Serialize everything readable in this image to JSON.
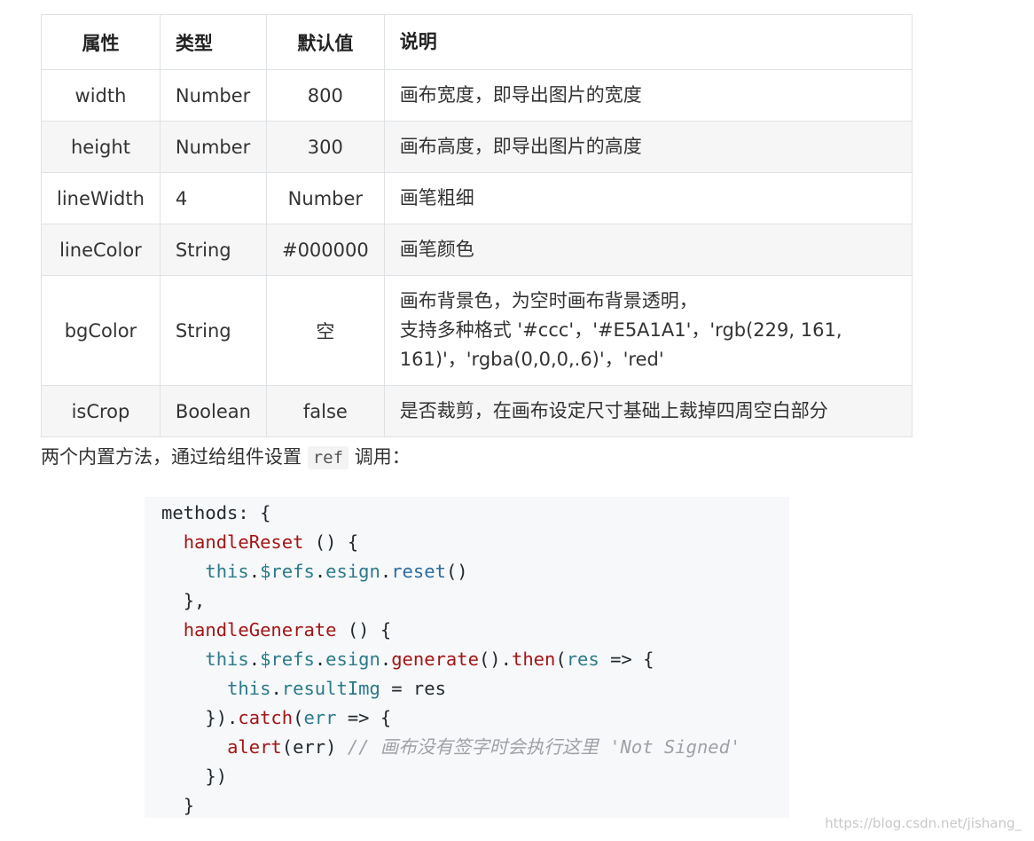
{
  "table": {
    "headers": [
      "属性",
      "类型",
      "默认值",
      "说明"
    ],
    "rows": [
      {
        "prop": "width",
        "type": "Number",
        "default": "800",
        "desc_lines": [
          "画布宽度，即导出图片的宽度"
        ]
      },
      {
        "prop": "height",
        "type": "Number",
        "default": "300",
        "desc_lines": [
          "画布高度，即导出图片的高度"
        ]
      },
      {
        "prop": "lineWidth",
        "type": "4",
        "default": "Number",
        "desc_lines": [
          "画笔粗细"
        ]
      },
      {
        "prop": "lineColor",
        "type": "String",
        "default": "#000000",
        "desc_lines": [
          "画笔颜色"
        ]
      },
      {
        "prop": "bgColor",
        "type": "String",
        "default": "空",
        "desc_lines": [
          "画布背景色，为空时画布背景透明，",
          "支持多种格式 '#ccc'，'#E5A1A1'，'rgb(229, 161,",
          "161)'，'rgba(0,0,0,.6)'，'red'"
        ]
      },
      {
        "prop": "isCrop",
        "type": "Boolean",
        "default": "false",
        "desc_lines": [
          "是否裁剪，在画布设定尺寸基础上裁掉四周空白部分"
        ]
      }
    ]
  },
  "intro": {
    "before": "两个内置方法，通过给组件设置 ",
    "code": "ref",
    "after": " 调用："
  },
  "code": {
    "l1_a": "methods: {",
    "l2_fn": "handleReset",
    "l2_rest": " () {",
    "l3_this": "this",
    "l3_dot1": ".",
    "l3_refs": "$refs",
    "l3_dot2": ".",
    "l3_esign": "esign",
    "l3_dot3": ".",
    "l3_reset": "reset",
    "l3_rest": "()",
    "l4": "},",
    "l5_fn": "handleGenerate",
    "l5_rest": " () {",
    "l6_this": "this",
    "l6_dot1": ".",
    "l6_refs": "$refs",
    "l6_dot2": ".",
    "l6_esign": "esign",
    "l6_dot3": ".",
    "l6_generate": "generate",
    "l6_mid": "().",
    "l6_then": "then",
    "l6_paren": "(",
    "l6_res": "res",
    "l6_rest": " => {",
    "l7_this": "this",
    "l7_dot": ".",
    "l7_result": "resultImg",
    "l7_rest": " = res",
    "l8_a": "}).",
    "l8_catch": "catch",
    "l8_paren": "(",
    "l8_err": "err",
    "l8_rest": " => {",
    "l9_alert": "alert",
    "l9_mid": "(err) ",
    "l9_comment": "// 画布没有签字时会执行这里 'Not Signed'",
    "l10": "})",
    "l11": "}"
  },
  "watermark": "https://blog.csdn.net/jishang_"
}
